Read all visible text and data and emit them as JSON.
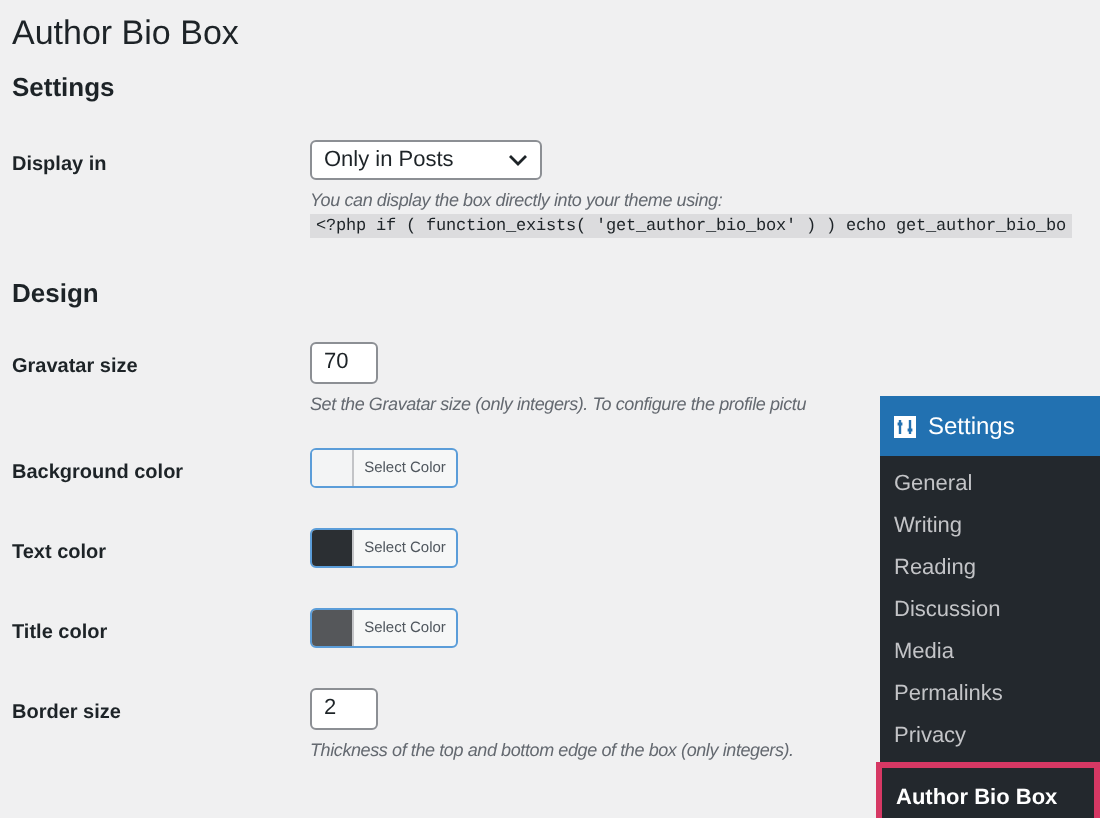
{
  "page_title": "Author Bio Box",
  "sections": [
    {
      "heading": "Settings",
      "fields": [
        {
          "kind": "select",
          "label": "Display in",
          "value": "Only in Posts",
          "help": "You can display the box directly into your theme using:",
          "code": "<?php if ( function_exists( 'get_author_bio_box' ) ) echo get_author_bio_bo"
        }
      ]
    },
    {
      "heading": "Design",
      "fields": [
        {
          "kind": "number",
          "label": "Gravatar size",
          "value": "70",
          "help": "Set the Gravatar size (only integers). To configure the profile pictu"
        },
        {
          "kind": "color",
          "label": "Background color",
          "color": "#f3f4f5",
          "button": "Select Color"
        },
        {
          "kind": "color",
          "label": "Text color",
          "color": "#2b2f33",
          "button": "Select Color"
        },
        {
          "kind": "color",
          "label": "Title color",
          "color": "#55575a",
          "button": "Select Color"
        },
        {
          "kind": "number",
          "label": "Border size",
          "value": "2",
          "help": "Thickness of the top and bottom edge of the box (only integers)."
        }
      ]
    }
  ],
  "settings_menu": {
    "title": "Settings",
    "items": [
      {
        "label": "General",
        "selected": false
      },
      {
        "label": "Writing",
        "selected": false
      },
      {
        "label": "Reading",
        "selected": false
      },
      {
        "label": "Discussion",
        "selected": false
      },
      {
        "label": "Media",
        "selected": false
      },
      {
        "label": "Permalinks",
        "selected": false
      },
      {
        "label": "Privacy",
        "selected": false
      },
      {
        "label": "Author Bio Box",
        "selected": true
      }
    ]
  }
}
